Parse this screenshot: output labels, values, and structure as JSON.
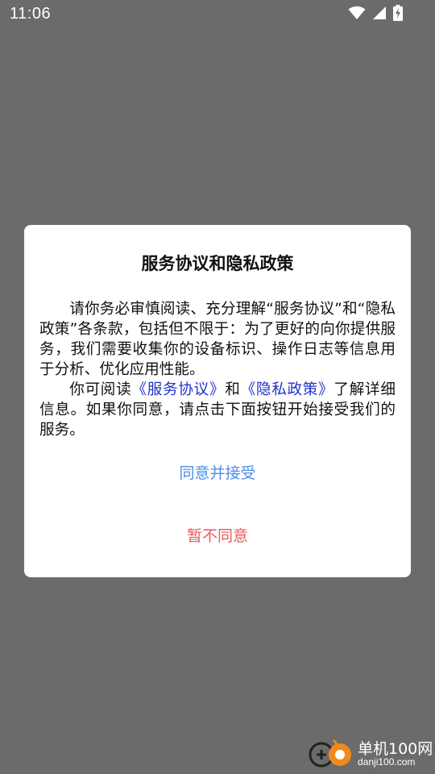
{
  "status_bar": {
    "time": "11:06",
    "icons": [
      "wifi-icon",
      "signal-icon",
      "battery-charging-icon"
    ]
  },
  "dialog": {
    "title": "服务协议和隐私政策",
    "paragraph1": "请你务必审慎阅读、充分理解“服务协议”和“隐私政策”各条款，包括但不限于：为了更好的向你提供服务，我们需要收集你的设备标识、操作日志等信息用于分析、优化应用性能。",
    "paragraph2": {
      "prefix": "你可阅读",
      "link1": "《服务协议》",
      "middle": "和",
      "link2": "《隐私政策》",
      "suffix": "了解详细信息。如果你同意，请点击下面按钮开始接受我们的服务。"
    },
    "accept_label": "同意并接受",
    "decline_label": "暂不同意"
  },
  "watermark": {
    "name": "单机100网",
    "url": "danji100.com"
  },
  "colors": {
    "overlay_background": "#6b6b6b",
    "dialog_background": "#ffffff",
    "link": "#2233cc",
    "accept": "#4d8fe8",
    "decline": "#e85a5a"
  }
}
